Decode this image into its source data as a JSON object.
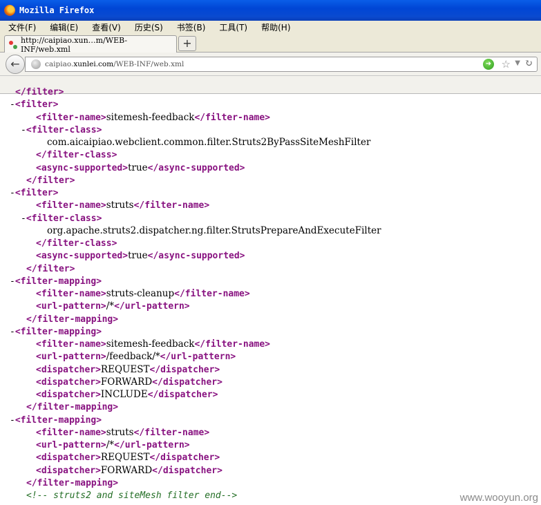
{
  "window": {
    "title": "Mozilla Firefox"
  },
  "menu": [
    "文件(F)",
    "编辑(E)",
    "查看(V)",
    "历史(S)",
    "书签(B)",
    "工具(T)",
    "帮助(H)"
  ],
  "tab": {
    "label": "http://caipiao.xun…m/WEB-INF/web.xml",
    "new_tab": "+"
  },
  "url": {
    "host": "caipiao.",
    "domain": "xunlei.com",
    "path": "/WEB-INF/web.xml"
  },
  "xml_lines": [
    {
      "indent": 0,
      "minus": false,
      "parts": [
        [
          "tag",
          "</filter>"
        ]
      ]
    },
    {
      "indent": 0,
      "minus": true,
      "parts": [
        [
          "tag",
          "<filter>"
        ]
      ]
    },
    {
      "indent": 2,
      "minus": false,
      "parts": [
        [
          "tag",
          "<filter-name>"
        ],
        [
          "txt",
          "sitemesh-feedback"
        ],
        [
          "tag",
          "</filter-name>"
        ]
      ]
    },
    {
      "indent": 1,
      "minus": true,
      "parts": [
        [
          "tag",
          "<filter-class>"
        ]
      ]
    },
    {
      "indent": 3,
      "minus": false,
      "parts": [
        [
          "txt",
          "com.aicaipiao.webclient.common.filter.Struts2ByPassSiteMeshFilter"
        ]
      ]
    },
    {
      "indent": 2,
      "minus": false,
      "parts": [
        [
          "tag",
          "</filter-class>"
        ]
      ]
    },
    {
      "indent": 2,
      "minus": false,
      "parts": [
        [
          "tag",
          "<async-supported>"
        ],
        [
          "txt",
          "true"
        ],
        [
          "tag",
          "</async-supported>"
        ]
      ]
    },
    {
      "indent": 1,
      "minus": false,
      "parts": [
        [
          "tag",
          "</filter>"
        ]
      ]
    },
    {
      "indent": 0,
      "minus": true,
      "parts": [
        [
          "tag",
          "<filter>"
        ]
      ]
    },
    {
      "indent": 2,
      "minus": false,
      "parts": [
        [
          "tag",
          "<filter-name>"
        ],
        [
          "txt",
          "struts"
        ],
        [
          "tag",
          "</filter-name>"
        ]
      ]
    },
    {
      "indent": 1,
      "minus": true,
      "parts": [
        [
          "tag",
          "<filter-class>"
        ]
      ]
    },
    {
      "indent": 3,
      "minus": false,
      "parts": [
        [
          "txt",
          "org.apache.struts2.dispatcher.ng.filter.StrutsPrepareAndExecuteFilter"
        ]
      ]
    },
    {
      "indent": 2,
      "minus": false,
      "parts": [
        [
          "tag",
          "</filter-class>"
        ]
      ]
    },
    {
      "indent": 2,
      "minus": false,
      "parts": [
        [
          "tag",
          "<async-supported>"
        ],
        [
          "txt",
          "true"
        ],
        [
          "tag",
          "</async-supported>"
        ]
      ]
    },
    {
      "indent": 1,
      "minus": false,
      "parts": [
        [
          "tag",
          "</filter>"
        ]
      ]
    },
    {
      "indent": 0,
      "minus": true,
      "parts": [
        [
          "tag",
          "<filter-mapping>"
        ]
      ]
    },
    {
      "indent": 2,
      "minus": false,
      "parts": [
        [
          "tag",
          "<filter-name>"
        ],
        [
          "txt",
          "struts-cleanup"
        ],
        [
          "tag",
          "</filter-name>"
        ]
      ]
    },
    {
      "indent": 2,
      "minus": false,
      "parts": [
        [
          "tag",
          "<url-pattern>"
        ],
        [
          "txt",
          "/*"
        ],
        [
          "tag",
          "</url-pattern>"
        ]
      ]
    },
    {
      "indent": 1,
      "minus": false,
      "parts": [
        [
          "tag",
          "</filter-mapping>"
        ]
      ]
    },
    {
      "indent": 0,
      "minus": true,
      "parts": [
        [
          "tag",
          "<filter-mapping>"
        ]
      ]
    },
    {
      "indent": 2,
      "minus": false,
      "parts": [
        [
          "tag",
          "<filter-name>"
        ],
        [
          "txt",
          "sitemesh-feedback"
        ],
        [
          "tag",
          "</filter-name>"
        ]
      ]
    },
    {
      "indent": 2,
      "minus": false,
      "parts": [
        [
          "tag",
          "<url-pattern>"
        ],
        [
          "txt",
          "/feedback/*"
        ],
        [
          "tag",
          "</url-pattern>"
        ]
      ]
    },
    {
      "indent": 2,
      "minus": false,
      "parts": [
        [
          "tag",
          "<dispatcher>"
        ],
        [
          "txt",
          "REQUEST"
        ],
        [
          "tag",
          "</dispatcher>"
        ]
      ]
    },
    {
      "indent": 2,
      "minus": false,
      "parts": [
        [
          "tag",
          "<dispatcher>"
        ],
        [
          "txt",
          "FORWARD"
        ],
        [
          "tag",
          "</dispatcher>"
        ]
      ]
    },
    {
      "indent": 2,
      "minus": false,
      "parts": [
        [
          "tag",
          "<dispatcher>"
        ],
        [
          "txt",
          "INCLUDE"
        ],
        [
          "tag",
          "</dispatcher>"
        ]
      ]
    },
    {
      "indent": 1,
      "minus": false,
      "parts": [
        [
          "tag",
          "</filter-mapping>"
        ]
      ]
    },
    {
      "indent": 0,
      "minus": true,
      "parts": [
        [
          "tag",
          "<filter-mapping>"
        ]
      ]
    },
    {
      "indent": 2,
      "minus": false,
      "parts": [
        [
          "tag",
          "<filter-name>"
        ],
        [
          "txt",
          "struts"
        ],
        [
          "tag",
          "</filter-name>"
        ]
      ]
    },
    {
      "indent": 2,
      "minus": false,
      "parts": [
        [
          "tag",
          "<url-pattern>"
        ],
        [
          "txt",
          "/*"
        ],
        [
          "tag",
          "</url-pattern>"
        ]
      ]
    },
    {
      "indent": 2,
      "minus": false,
      "parts": [
        [
          "tag",
          "<dispatcher>"
        ],
        [
          "txt",
          "REQUEST"
        ],
        [
          "tag",
          "</dispatcher>"
        ]
      ]
    },
    {
      "indent": 2,
      "minus": false,
      "parts": [
        [
          "tag",
          "<dispatcher>"
        ],
        [
          "txt",
          "FORWARD"
        ],
        [
          "tag",
          "</dispatcher>"
        ]
      ]
    },
    {
      "indent": 1,
      "minus": false,
      "parts": [
        [
          "tag",
          "</filter-mapping>"
        ]
      ]
    },
    {
      "indent": 1,
      "minus": false,
      "parts": [
        [
          "comment",
          "<!-- struts2 and siteMesh filter end-->"
        ]
      ]
    }
  ],
  "watermark": "www.wooyun.org"
}
